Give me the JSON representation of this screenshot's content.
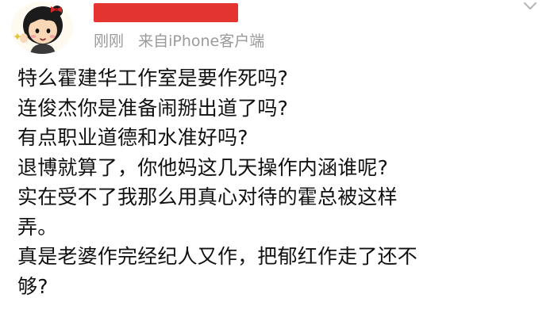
{
  "post": {
    "time": "刚刚",
    "source_prefix": "来自",
    "source_device": "iPhone客户端",
    "lines": [
      "特么霍建华工作室是要作死吗?",
      "连俊杰你是准备闹掰出道了吗?",
      "有点职业道德和水准好吗?",
      "退博就算了，你他妈这几天操作内涵谁呢?",
      "实在受不了我那么用真心对待的霍总被这样",
      "弄。",
      "真是老婆作完经纪人又作，把郁红作走了还不",
      "够?"
    ]
  },
  "colors": {
    "redaction": "#e3342f",
    "meta_text": "#9a9a9a",
    "body_text": "#111111",
    "background": "#ffffff"
  },
  "icons": {
    "avatar": "cartoon-girl-avatar",
    "menu": "chevron-down-icon"
  }
}
